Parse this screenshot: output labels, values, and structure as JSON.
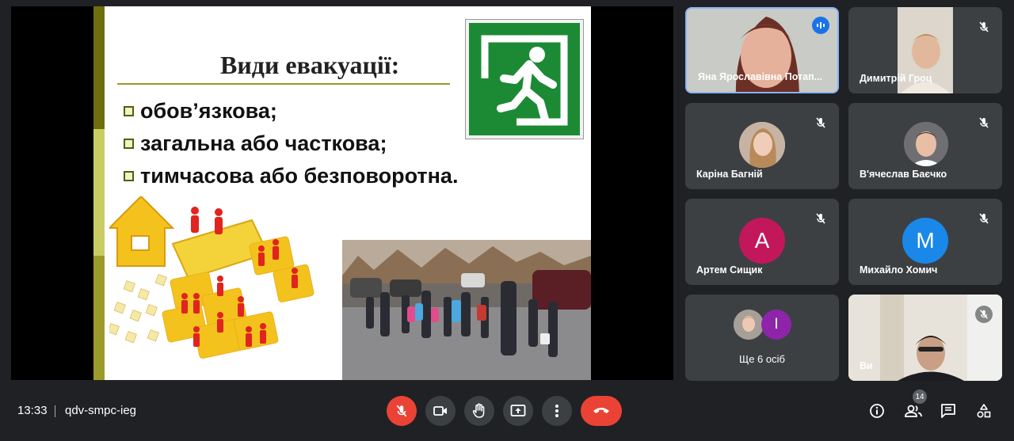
{
  "meeting": {
    "time": "13:33",
    "code": "qdv-smpc-ieg"
  },
  "slide": {
    "title": "Види евакуації:",
    "bullets": [
      "обов’язкова;",
      "загальна або часткова;",
      "тимчасова або безповоротна."
    ]
  },
  "participants": [
    {
      "name": "Яна Ярославівна Потап...",
      "status": "speaking"
    },
    {
      "name": "Димитрій Гроц",
      "status": "muted"
    },
    {
      "name": "Каріна Багній",
      "status": "muted"
    },
    {
      "name": "В'ячеслав Баєчко",
      "status": "muted"
    },
    {
      "name": "Артем Сищик",
      "initial": "A",
      "color": "#c2185b",
      "status": "muted"
    },
    {
      "name": "Михайло Хомич",
      "initial": "M",
      "color": "#1a88e8",
      "status": "muted"
    },
    {
      "name": "Ще 6 осіб",
      "initial": "I",
      "color": "#8e24aa"
    },
    {
      "name": "Ви",
      "status": "muted"
    }
  ],
  "controls": {
    "participant_count": "14"
  },
  "colors": {
    "accent": "#8ab4f8",
    "end_call": "#ea4335",
    "mic_off": "#ea4335",
    "exit_sign": "#1c8a34"
  }
}
